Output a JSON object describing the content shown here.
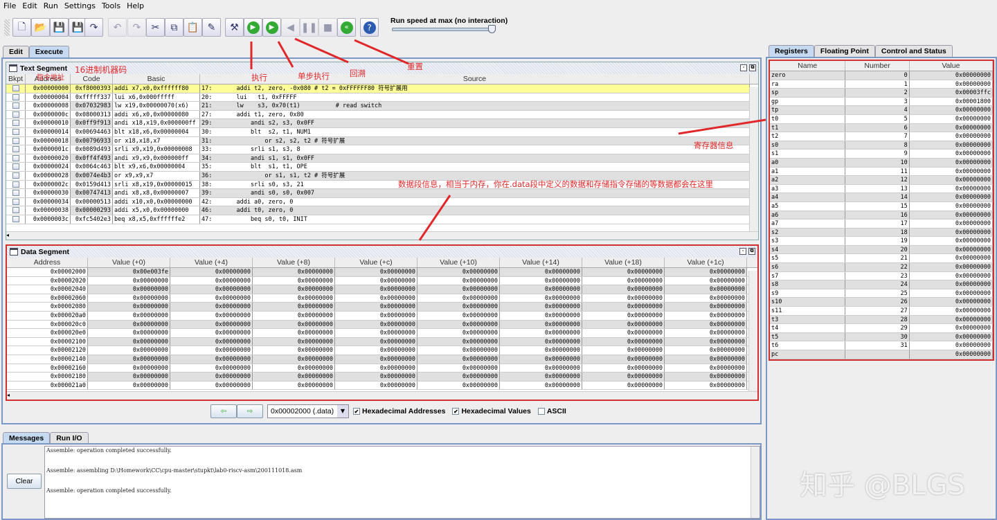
{
  "menu": [
    "File",
    "Edit",
    "Run",
    "Settings",
    "Tools",
    "Help"
  ],
  "toolbar": {
    "icons": [
      "new-file-icon",
      "open-file-icon",
      "save-icon",
      "save-as-icon",
      "dump-memory-icon",
      "undo-icon",
      "redo-icon",
      "cut-icon",
      "copy-icon",
      "paste-icon",
      "find-replace-icon",
      "assemble-icon",
      "run-icon",
      "step-icon",
      "backstep-icon",
      "pause-icon",
      "stop-icon",
      "reset-icon",
      "help-icon"
    ],
    "speed_label": "Run speed at max (no interaction)",
    "speed_level": 1.0
  },
  "main_tabs": [
    "Edit",
    "Execute"
  ],
  "text_segment": {
    "title": "Text Segment",
    "columns": [
      "Bkpt",
      "Address",
      "Code",
      "Basic",
      "Source"
    ],
    "rows": [
      [
        "0x00000000",
        "0xf8000393",
        "addi x7,x0,0xffffff80",
        "17:",
        "    addi t2, zero, -0x080 # t2 = 0xFFFFFF80 符号扩展用"
      ],
      [
        "0x00000004",
        "0xfffff337",
        "lui x6,0x000fffff",
        "20:",
        "    lui   t1, 0xFFFFF"
      ],
      [
        "0x00000008",
        "0x07032983",
        "lw x19,0x00000070(x6)",
        "21:",
        "    lw    s3, 0x70(t1)          # read switch"
      ],
      [
        "0x0000000c",
        "0x08000313",
        "addi x6,x0,0x00000080",
        "27:",
        "    addi t1, zero, 0x80"
      ],
      [
        "0x00000010",
        "0x0ff9f913",
        "andi x18,x19,0x000000ff",
        "29:",
        "        andi s2, s3, 0x0FF"
      ],
      [
        "0x00000014",
        "0x00694463",
        "blt x18,x6,0x00000004",
        "30:",
        "        blt  s2, t1, NUM1"
      ],
      [
        "0x00000018",
        "0x00796933",
        "or x18,x18,x7",
        "31:",
        "            or s2, s2, t2 # 符号扩展"
      ],
      [
        "0x0000001c",
        "0x0089d493",
        "srli x9,x19,0x00000008",
        "33:",
        "        srli s1, s3, 8"
      ],
      [
        "0x00000020",
        "0x0ff4f493",
        "andi x9,x9,0x000000ff",
        "34:",
        "        andi s1, s1, 0x0FF"
      ],
      [
        "0x00000024",
        "0x0064c463",
        "blt x9,x6,0x00000004",
        "35:",
        "        blt  s1, t1, OPE"
      ],
      [
        "0x00000028",
        "0x0074e4b3",
        "or x9,x9,x7",
        "36:",
        "            or s1, s1, t2 # 符号扩展"
      ],
      [
        "0x0000002c",
        "0x0159d413",
        "srli x8,x19,0x00000015",
        "38:",
        "        srli s0, s3, 21"
      ],
      [
        "0x00000030",
        "0x00747413",
        "andi x8,x8,0x00000007",
        "39:",
        "        andi s0, s0, 0x007"
      ],
      [
        "0x00000034",
        "0x00000513",
        "addi x10,x0,0x00000000",
        "42:",
        "    addi a0, zero, 0"
      ],
      [
        "0x00000038",
        "0x00000293",
        "addi x5,x0,0x00000000",
        "46:",
        "    addi t0, zero, 0"
      ],
      [
        "0x0000003c",
        "0xfc5402e3",
        "beq x8,x5,0xffffffe2",
        "47:",
        "        beq s0, t0, INIT"
      ]
    ]
  },
  "data_segment": {
    "title": "Data Segment",
    "columns": [
      "Address",
      "Value (+0)",
      "Value (+4)",
      "Value (+8)",
      "Value (+c)",
      "Value (+10)",
      "Value (+14)",
      "Value (+18)",
      "Value (+1c)"
    ],
    "addresses": [
      "0x00002000",
      "0x00002020",
      "0x00002040",
      "0x00002060",
      "0x00002080",
      "0x000020a0",
      "0x000020c0",
      "0x000020e0",
      "0x00002100",
      "0x00002120",
      "0x00002140",
      "0x00002160",
      "0x00002180",
      "0x000021a0"
    ],
    "first_value": "0x00e003fe",
    "default_value": "0x00000000",
    "segment_select": "0x00002000 (.data)",
    "hex_addresses_label": "Hexadecimal Addresses",
    "hex_addresses": true,
    "hex_values_label": "Hexadecimal Values",
    "hex_values": true,
    "ascii_label": "ASCII",
    "ascii": false
  },
  "bottom_tabs": [
    "Messages",
    "Run I/O"
  ],
  "messages": {
    "clear_label": "Clear",
    "lines": [
      "Assemble: operation completed successfully.",
      "Assemble: assembling D:\\Homework\\CC\\cpu-master\\stupkt\\lab0-riscv-asm\\200111018.asm",
      "Assemble: operation completed successfully."
    ]
  },
  "right_tabs": [
    "Registers",
    "Floating Point",
    "Control and Status"
  ],
  "registers": {
    "columns": [
      "Name",
      "Number",
      "Value"
    ],
    "rows": [
      [
        "zero",
        "0",
        "0x00000000"
      ],
      [
        "ra",
        "1",
        "0x00000000"
      ],
      [
        "sp",
        "2",
        "0x00003ffc"
      ],
      [
        "gp",
        "3",
        "0x00001800"
      ],
      [
        "tp",
        "4",
        "0x00000000"
      ],
      [
        "t0",
        "5",
        "0x00000000"
      ],
      [
        "t1",
        "6",
        "0x00000000"
      ],
      [
        "t2",
        "7",
        "0x00000000"
      ],
      [
        "s0",
        "8",
        "0x00000000"
      ],
      [
        "s1",
        "9",
        "0x00000000"
      ],
      [
        "a0",
        "10",
        "0x00000000"
      ],
      [
        "a1",
        "11",
        "0x00000000"
      ],
      [
        "a2",
        "12",
        "0x00000000"
      ],
      [
        "a3",
        "13",
        "0x00000000"
      ],
      [
        "a4",
        "14",
        "0x00000000"
      ],
      [
        "a5",
        "15",
        "0x00000000"
      ],
      [
        "a6",
        "16",
        "0x00000000"
      ],
      [
        "a7",
        "17",
        "0x00000000"
      ],
      [
        "s2",
        "18",
        "0x00000000"
      ],
      [
        "s3",
        "19",
        "0x00000000"
      ],
      [
        "s4",
        "20",
        "0x00000000"
      ],
      [
        "s5",
        "21",
        "0x00000000"
      ],
      [
        "s6",
        "22",
        "0x00000000"
      ],
      [
        "s7",
        "23",
        "0x00000000"
      ],
      [
        "s8",
        "24",
        "0x00000000"
      ],
      [
        "s9",
        "25",
        "0x00000000"
      ],
      [
        "s10",
        "26",
        "0x00000000"
      ],
      [
        "s11",
        "27",
        "0x00000000"
      ],
      [
        "t3",
        "28",
        "0x00000000"
      ],
      [
        "t4",
        "29",
        "0x00000000"
      ],
      [
        "t5",
        "30",
        "0x00000000"
      ],
      [
        "t6",
        "31",
        "0x00000000"
      ],
      [
        "pc",
        "",
        "0x00000000"
      ]
    ]
  },
  "annotations": {
    "hex_code": "16进制机器码",
    "address": "指令地址",
    "run": "执行",
    "step": "单步执行",
    "backstep": "回溯",
    "reset": "重置",
    "registers": "寄存器信息",
    "data": "数据段信息，相当于内存，你在.data段中定义的数据和存储指令存储的等数据都会在这里",
    "color": "#e0282a"
  },
  "watermark": "知乎 @BLGS"
}
